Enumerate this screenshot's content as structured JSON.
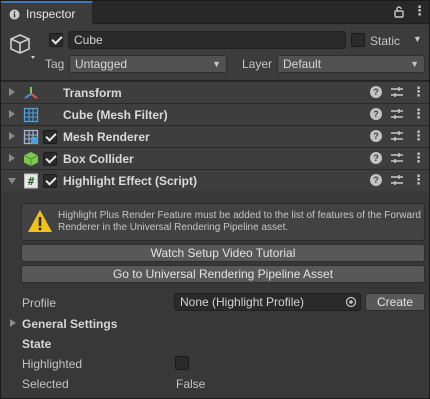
{
  "tab": {
    "title": "Inspector",
    "lock_icon": "lock-icon",
    "menu_icon": "kebab-menu-icon"
  },
  "object": {
    "active": true,
    "name": "Cube",
    "static_label": "Static",
    "static_checked": false,
    "tag_label": "Tag",
    "tag_value": "Untagged",
    "layer_label": "Layer",
    "layer_value": "Default"
  },
  "components": [
    {
      "name": "Transform",
      "icon": "transform-icon",
      "has_toggle": false,
      "expanded": false
    },
    {
      "name": "Cube (Mesh Filter)",
      "icon": "mesh-filter-icon",
      "has_toggle": false,
      "expanded": false
    },
    {
      "name": "Mesh Renderer",
      "icon": "mesh-renderer-icon",
      "has_toggle": true,
      "enabled": true,
      "expanded": false
    },
    {
      "name": "Box Collider",
      "icon": "box-collider-icon",
      "has_toggle": true,
      "enabled": true,
      "expanded": false
    },
    {
      "name": "Highlight Effect (Script)",
      "icon": "script-icon",
      "has_toggle": true,
      "enabled": true,
      "expanded": true
    }
  ],
  "highlight": {
    "warning": "Highlight Plus Render Feature must be added to the list of features of the Forward Renderer in the Universal Rendering Pipeline asset.",
    "btn_video": "Watch Setup Video Tutorial",
    "btn_urp": "Go to Universal Rendering Pipeline Asset",
    "profile_label": "Profile",
    "profile_value": "None (Highlight Profile)",
    "create_label": "Create",
    "general_settings": "General Settings",
    "state_header": "State",
    "highlighted_label": "Highlighted",
    "highlighted_value": false,
    "selected_label": "Selected",
    "selected_value": "False"
  },
  "colors": {
    "accent": "#3a79bb",
    "warning": "#f1c21b",
    "collider_green": "#7ec850"
  }
}
